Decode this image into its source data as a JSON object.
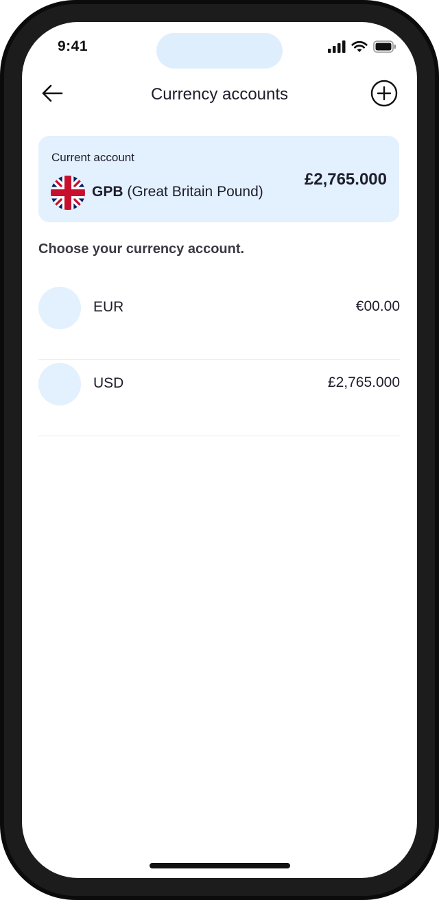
{
  "status_bar": {
    "time": "9:41",
    "icons": [
      "signal-icon",
      "wifi-icon",
      "battery-icon"
    ]
  },
  "header": {
    "title": "Currency accounts",
    "back_icon": "arrow-left-icon",
    "add_icon": "plus-circle-icon"
  },
  "current_account": {
    "label": "Current account",
    "flag_icon": "uk-flag-icon",
    "currency_code": "GPB",
    "currency_name": "(Great Britain Pound)",
    "amount": "£2,765.000"
  },
  "section_title": "Choose your currency account.",
  "accounts": [
    {
      "code": "EUR",
      "amount": "€00.00"
    },
    {
      "code": "USD",
      "amount": "£2,765.000"
    }
  ],
  "colors": {
    "accent_light": "#e3f0fd",
    "text_dark": "#1d1d2b",
    "frame": "#0b0b0b"
  }
}
